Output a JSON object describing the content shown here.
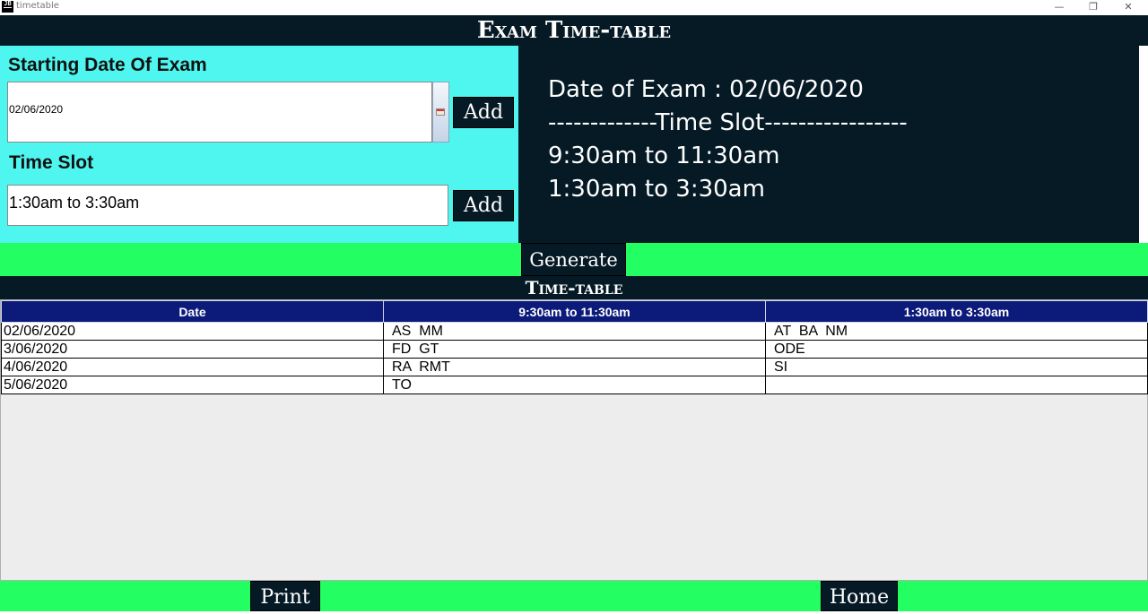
{
  "window": {
    "title": "timetable",
    "icon_label": "JB",
    "controls": {
      "minimize": "—",
      "maximize": "❐",
      "close": "✕"
    }
  },
  "header": {
    "title": "Exam Time-table"
  },
  "inputs": {
    "start_date_label": "Starting Date Of Exam",
    "start_date_value": "02/06/2020",
    "time_slot_label": "Time Slot",
    "time_slot_value": "1:30am to 3:30am",
    "add_date_label": "Add",
    "add_slot_label": "Add"
  },
  "summary": {
    "lines": [
      "Date of Exam : 02/06/2020",
      "-------------Time Slot-----------------",
      "9:30am to 11:30am",
      "1:30am to 3:30am"
    ]
  },
  "generate_label": "Generate",
  "timetable": {
    "title": "Time-table",
    "columns": [
      "Date",
      "9:30am to 11:30am",
      "1:30am to 3:30am"
    ],
    "rows": [
      [
        "02/06/2020",
        "AS  MM",
        "AT  BA  NM"
      ],
      [
        "3/06/2020",
        "FD  GT",
        "ODE"
      ],
      [
        "4/06/2020",
        "RA  RMT",
        "SI"
      ],
      [
        "5/06/2020",
        "TO",
        ""
      ]
    ]
  },
  "footer": {
    "print_label": "Print",
    "home_label": "Home"
  },
  "colors": {
    "dark": "#061a26",
    "cyan": "#4ef6ef",
    "green": "#23ff63",
    "table_header": "#0c1a7a"
  },
  "icons": {
    "date_picker": "calendar-icon"
  }
}
